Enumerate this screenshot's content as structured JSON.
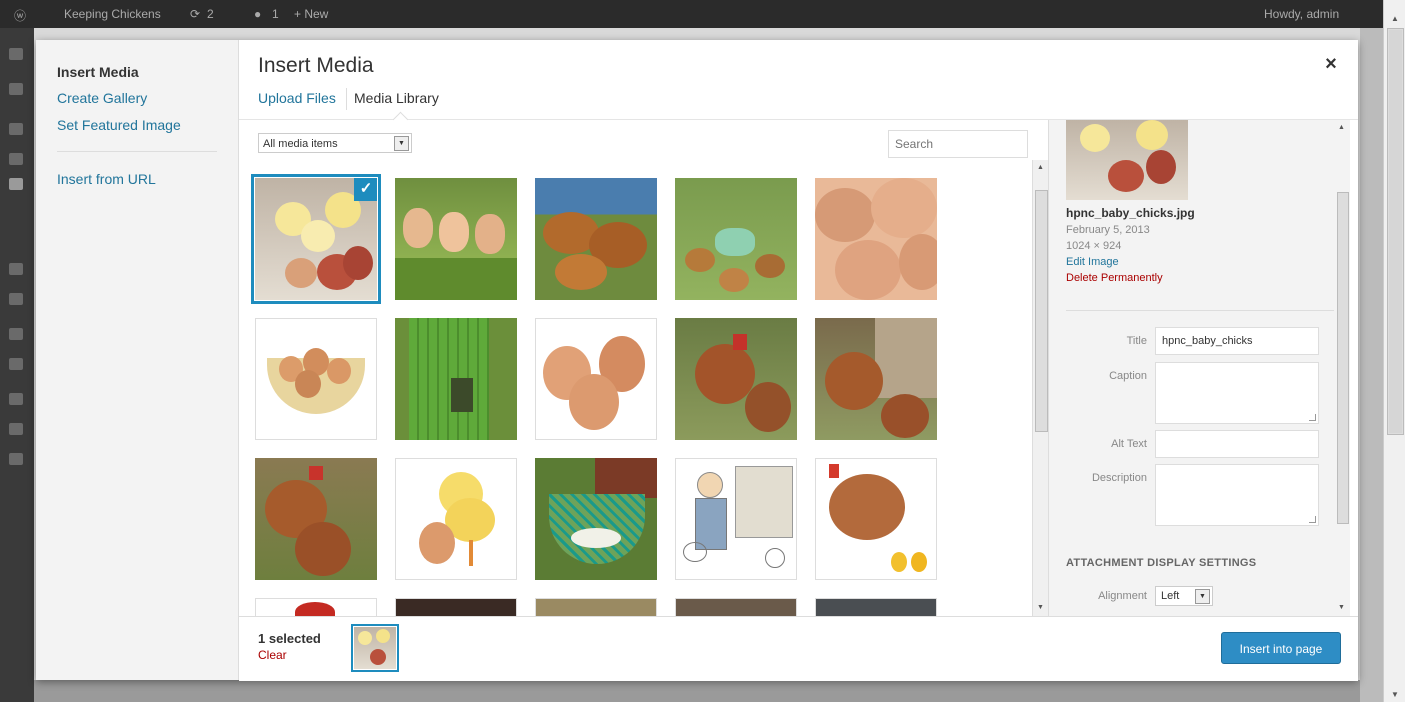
{
  "admin_bar": {
    "site_name": "Keeping Chickens",
    "updates": "2",
    "comments": "1",
    "new_label": "+ New",
    "howdy": "Howdy, admin"
  },
  "modal": {
    "title": "Insert Media",
    "close_glyph": "×",
    "menu": [
      {
        "label": "Insert Media",
        "active": true
      },
      {
        "label": "Create Gallery",
        "active": false
      },
      {
        "label": "Set Featured Image",
        "active": false
      },
      {
        "label": "Insert from URL",
        "active": false
      }
    ],
    "tabs": [
      {
        "label": "Upload Files"
      },
      {
        "label": "Media Library"
      }
    ],
    "filter": {
      "value": "All media items"
    },
    "search": {
      "placeholder": "Search"
    },
    "grid": [
      {
        "alt": "baby chicks with eggs",
        "selected": true
      },
      {
        "alt": "girls with chicks"
      },
      {
        "alt": "hens in grass"
      },
      {
        "alt": "chickens with feeder"
      },
      {
        "alt": "brown eggs"
      },
      {
        "alt": "bowl of eggs"
      },
      {
        "alt": "green coop"
      },
      {
        "alt": "three eggs"
      },
      {
        "alt": "rooster and hens"
      },
      {
        "alt": "hens by coop"
      },
      {
        "alt": "hens"
      },
      {
        "alt": "chick on egg"
      },
      {
        "alt": "egg basket"
      },
      {
        "alt": "farmer illustration"
      },
      {
        "alt": "hen illustration"
      },
      {
        "alt": "partial 1"
      },
      {
        "alt": "partial 2"
      },
      {
        "alt": "partial 3"
      },
      {
        "alt": "partial 4"
      },
      {
        "alt": "partial 5"
      }
    ],
    "details": {
      "filename": "hpnc_baby_chicks.jpg",
      "date": "February 5, 2013",
      "dimensions": "1024 × 924",
      "edit_link": "Edit Image",
      "delete_link": "Delete Permanently",
      "fields": {
        "title_label": "Title",
        "title_value": "hpnc_baby_chicks",
        "caption_label": "Caption",
        "alt_label": "Alt Text",
        "description_label": "Description"
      },
      "display_settings_heading": "ATTACHMENT DISPLAY SETTINGS",
      "alignment_label": "Alignment",
      "alignment_value": "Left"
    },
    "footer": {
      "selected_text": "1 selected",
      "clear_label": "Clear",
      "insert_label": "Insert into page"
    }
  },
  "colors": {
    "accent": "#1e8cbe",
    "button": "#2e8dc5",
    "link": "#21759b",
    "danger": "#a00"
  }
}
